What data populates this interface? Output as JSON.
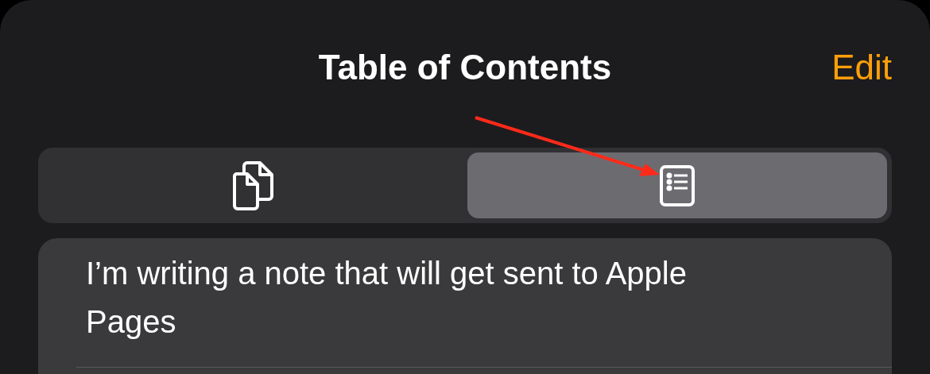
{
  "sheet": {
    "title": "Table of Contents",
    "edit_button": "Edit"
  },
  "tabs": [
    {
      "kind": "pages",
      "selected": false
    },
    {
      "kind": "contents",
      "selected": true
    }
  ],
  "entries": [
    {
      "text": "I’m writing a note that will get sent to Apple Pages"
    }
  ]
}
